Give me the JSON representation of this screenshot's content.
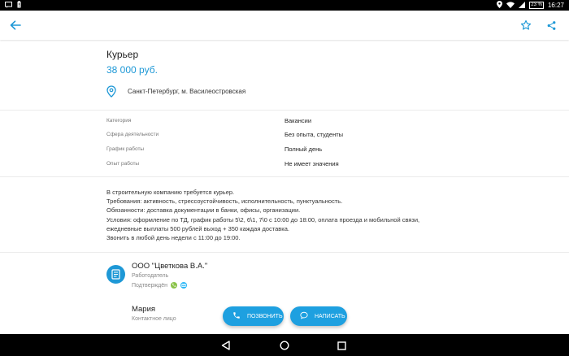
{
  "status_bar": {
    "left_icons": [
      "message-icon",
      "battery-alert-icon"
    ],
    "battery_percent": "23 %",
    "time": "16:27"
  },
  "toolbar": {
    "back_icon": "arrow-left-icon",
    "favorite_icon": "star-outline-icon",
    "share_icon": "share-icon",
    "accent_color": "#1e98d6"
  },
  "job": {
    "title": "Курьер",
    "salary": "38 000 руб.",
    "location": "Санкт-Петербург, м. Василеостровская"
  },
  "properties": [
    {
      "label": "Категория",
      "value": "Вакансии"
    },
    {
      "label": "Сфера деятельности",
      "value": "Без опыта, студенты"
    },
    {
      "label": "График работы",
      "value": "Полный день"
    },
    {
      "label": "Опыт работы",
      "value": "Не имеет значения"
    }
  ],
  "description": {
    "lines": [
      "В строительную компанию требуется курьер.",
      "Требования: активность, стрессоустойчивость, исполнительность, пунктуальность.",
      "Обязанности: доставка документации в банки, офисы, организации.",
      "Условия: оформление по ТД, график работы 5\\2, 6\\1, 7\\0 с 10:00 до 18:00, оплата проезда и мобильной связи,",
      "ежедневные выплаты 500 рублей выход + 350 каждая доставка.",
      "Звонить в любой день недели с 11:00 до 19:00."
    ]
  },
  "employer": {
    "name": "ООО \"Цветкова В.А.\"",
    "role": "Работодатель",
    "verified_label": "Подтверждён"
  },
  "contact": {
    "name": "Мария",
    "role": "Контактное лицо"
  },
  "actions": {
    "call_label": "ПОЗВОНИТЬ",
    "write_label": "НАПИСАТЬ"
  }
}
